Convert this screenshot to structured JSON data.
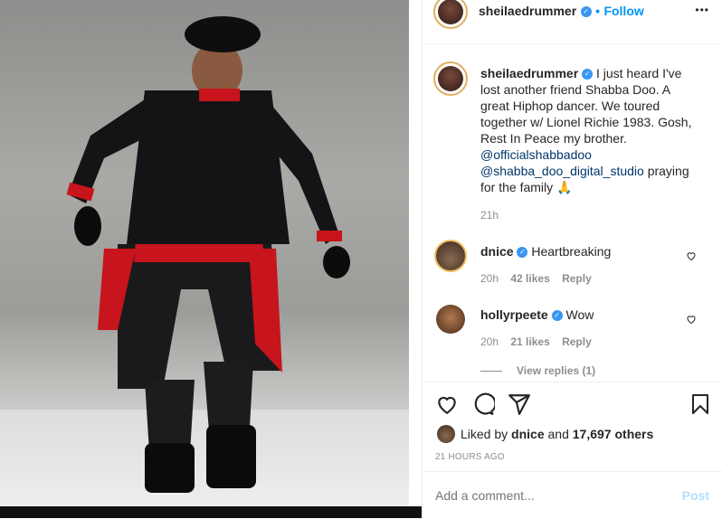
{
  "post": {
    "author": "sheilaedrummer",
    "follow_label": "Follow",
    "more_label": "•••",
    "caption_lines": [
      "I just heard I've",
      "lost another friend Shabba Doo. A",
      "great Hiphop dancer. We toured",
      "together w/ Lionel Richie 1983. Gosh,",
      "Rest In Peace my brother."
    ],
    "mention1": "@officialshabbadoo",
    "mention2": "@shabba_doo_digital_studio",
    "caption_tail1": "praying",
    "caption_tail2": "for the family",
    "caption_emoji": "🙏",
    "caption_time": "21h",
    "liked_prefix": "Liked by",
    "liked_user": "dnice",
    "liked_and": "and",
    "liked_count": "17,697 others",
    "timestamp": "21 HOURS AGO"
  },
  "comments": [
    {
      "user": "dnice",
      "text": "Heartbreaking",
      "time": "20h",
      "likes": "42 likes",
      "reply": "Reply"
    },
    {
      "user": "hollyrpeete",
      "text": "Wow",
      "time": "20h",
      "likes": "21 likes",
      "reply": "Reply"
    }
  ],
  "view_replies": "View replies (1)",
  "add_comment": {
    "placeholder": "Add a comment...",
    "post_label": "Post"
  },
  "colors": {
    "accent": "#0095f6",
    "muted": "#8e8e8e",
    "verified": "#3897f0"
  },
  "icons": [
    "heart-icon",
    "comment-icon",
    "share-icon",
    "bookmark-icon",
    "verified-icon",
    "more-icon"
  ]
}
